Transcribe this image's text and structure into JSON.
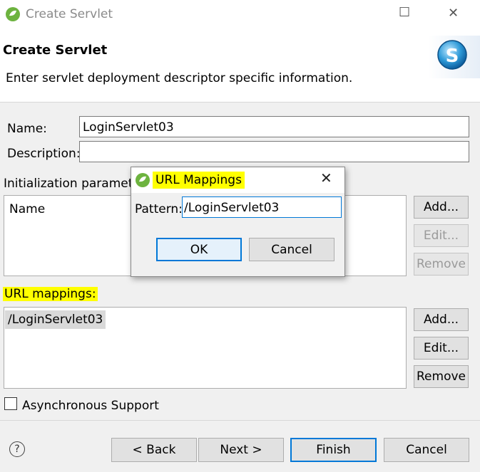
{
  "window": {
    "title": "Create Servlet",
    "minimize_icon": "☐",
    "close_icon": "✕"
  },
  "header": {
    "title": "Create Servlet",
    "description": "Enter servlet deployment descriptor specific information.",
    "logo_letter": "S"
  },
  "form": {
    "name_label": "Name:",
    "name_value": "LoginServlet03",
    "description_label": "Description:",
    "description_value": "",
    "init_params_label": "Initialization paramete",
    "init_params_column": "Name",
    "init_buttons": {
      "add": "Add...",
      "edit": "Edit...",
      "remove": "Remove"
    },
    "url_mappings_label": "URL mappings:",
    "url_mappings": [
      "/LoginServlet03"
    ],
    "url_buttons": {
      "add": "Add...",
      "edit": "Edit...",
      "remove": "Remove"
    },
    "async_label": "Asynchronous Support",
    "async_checked": false
  },
  "dialog": {
    "title": "URL Mappings",
    "pattern_label": "Pattern:",
    "pattern_value": "/LoginServlet03",
    "ok_label": "OK",
    "cancel_label": "Cancel"
  },
  "footer": {
    "help_icon": "?",
    "back_label": "< Back",
    "next_label": "Next >",
    "finish_label": "Finish",
    "cancel_label": "Cancel"
  },
  "colors": {
    "highlight": "#ffff00",
    "spring_green": "#6db33f",
    "default_button_border": "#0078d7"
  }
}
